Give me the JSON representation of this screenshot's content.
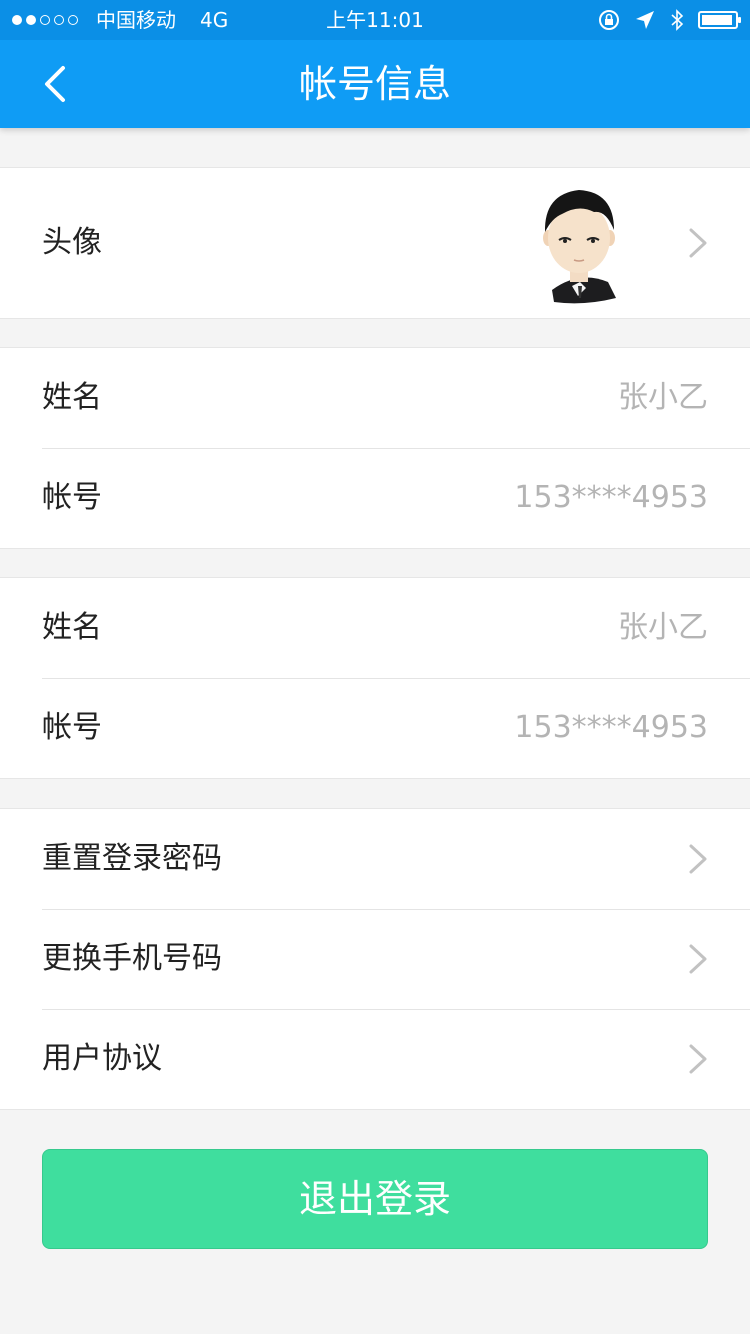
{
  "status_bar": {
    "signal_dots": [
      true,
      true,
      false,
      false,
      false
    ],
    "carrier": "中国移动",
    "network": "4G",
    "time": "上午11:01",
    "battery_level": 0.95
  },
  "nav": {
    "back_icon": "chevron-left-icon",
    "title": "帐号信息"
  },
  "profile": {
    "avatar_label": "头像"
  },
  "info_group_1": [
    {
      "label": "姓名",
      "value": "张小乙"
    },
    {
      "label": "帐号",
      "value": "153****4953"
    }
  ],
  "info_group_2": [
    {
      "label": "姓名",
      "value": "张小乙"
    },
    {
      "label": "帐号",
      "value": "153****4953"
    }
  ],
  "actions": [
    {
      "label": "重置登录密码"
    },
    {
      "label": "更换手机号码"
    },
    {
      "label": "用户协议"
    }
  ],
  "logout": {
    "label": "退出登录"
  },
  "colors": {
    "nav_bg": "#0f9cf5",
    "logout_bg": "#3fde9e",
    "value_text": "#b4b4b4"
  }
}
